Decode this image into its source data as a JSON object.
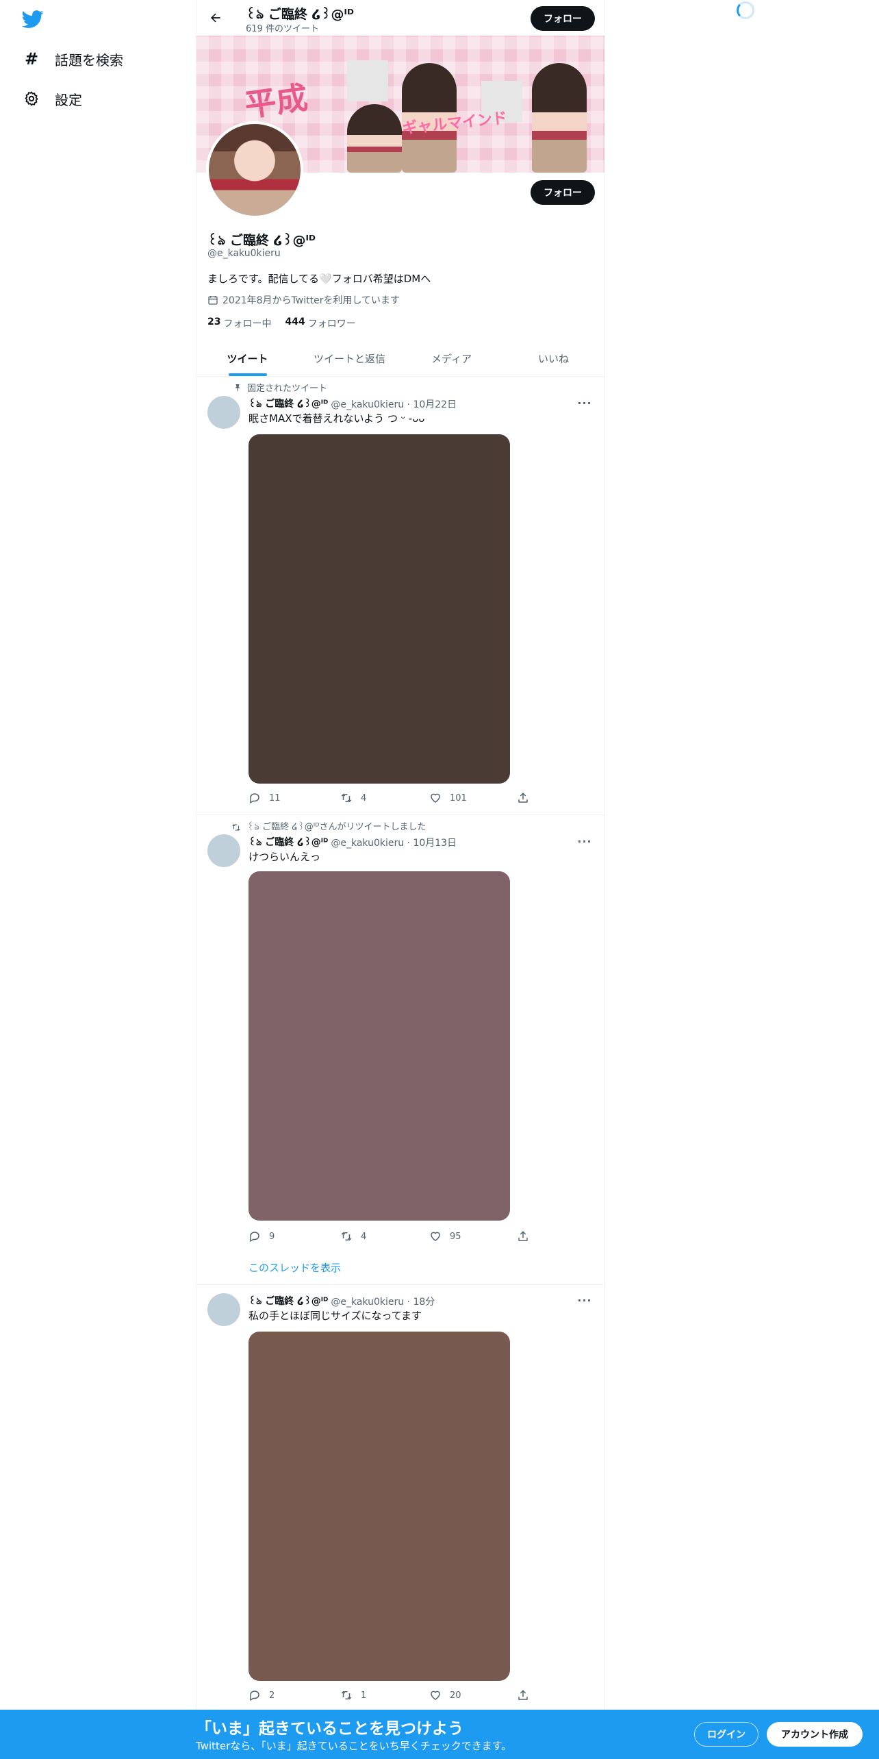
{
  "sidebar": {
    "items": [
      {
        "label": "話題を検索",
        "icon": "hashtag-icon"
      },
      {
        "label": "設定",
        "icon": "gear-icon"
      }
    ]
  },
  "header": {
    "name": "꒰ঌ ご臨終 ໒꒱@ᴵᴰ",
    "tweet_count": "619 件のツイート",
    "follow_label": "フォロー"
  },
  "banner": {
    "text_a": "平成",
    "text_b": "ギャルマインド"
  },
  "profile": {
    "name": "꒰ঌ ご臨終 ໒꒱@ᴵᴰ",
    "handle": "@e_kaku0kieru",
    "bio": "ましろです。配信してる🤍フォロバ希望はDMへ",
    "joined": "2021年8月からTwitterを利用しています",
    "following_count": "23",
    "following_label": "フォロー中",
    "followers_count": "444",
    "followers_label": "フォロワー",
    "follow_label": "フォロー"
  },
  "tabs": [
    "ツイート",
    "ツイートと返信",
    "メディア",
    "いいね"
  ],
  "tweets": [
    {
      "context": "固定されたツイート",
      "name": "꒰ঌ ご臨終 ໒꒱@ᴵᴰ",
      "meta": "@e_kaku0kieru · 10月22日",
      "text": "眠さMAXで着替えれないよう  つ ᵕ -ᴗᴗ",
      "media_color": "#4b3b35",
      "reply": "11",
      "retweet": "4",
      "like": "101"
    },
    {
      "context": "꒰ঌ ご臨終 ໒꒱@ᴵᴰさんがリツイートしました",
      "name": "꒰ঌ ご臨終 ໒꒱@ᴵᴰ",
      "meta": "@e_kaku0kieru · 10月13日",
      "text": "けつらいんえっ",
      "media_color": "#806368",
      "reply": "9",
      "retweet": "4",
      "like": "95",
      "thread_link": "このスレッドを表示"
    },
    {
      "name": "꒰ঌ ご臨終 ໒꒱@ᴵᴰ",
      "meta": "@e_kaku0kieru · 18分",
      "text": "私の手とほぼ同じサイズになってます",
      "media_color": "#77594f",
      "reply": "2",
      "retweet": "1",
      "like": "20"
    }
  ],
  "bottom_bar": {
    "title": "「いま」起きていることを見つけよう",
    "subtitle": "Twitterなら、「いま」起きていることをいち早くチェックできます。",
    "login": "ログイン",
    "signup": "アカウント作成"
  },
  "colors": {
    "accent": "#1d9bf0",
    "dark_button": "#0f1419",
    "secondary_text": "#536471"
  }
}
